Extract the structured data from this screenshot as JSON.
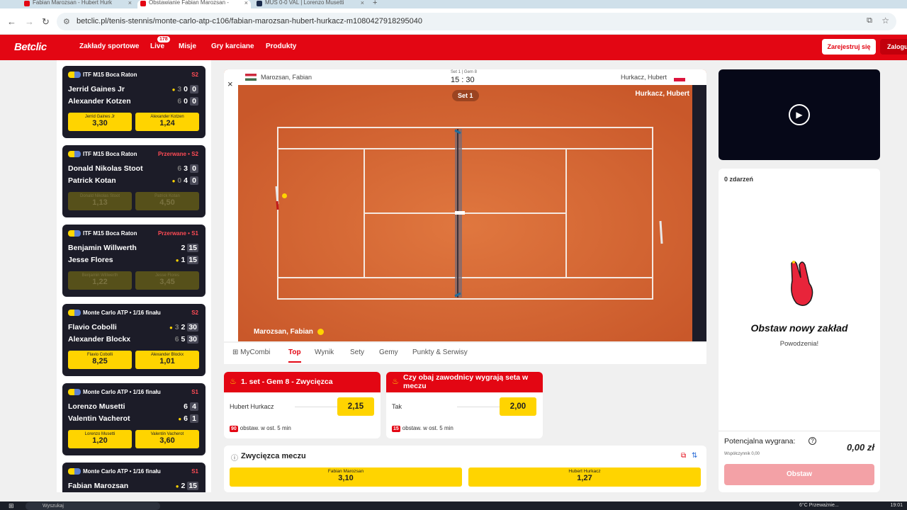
{
  "browser": {
    "tabs": [
      {
        "label": "Fabian Marozsan - Hubert Hurk",
        "active": false
      },
      {
        "label": "Obstawianie Fabian Marozsan -",
        "active": true
      },
      {
        "label": "MUS 0-0 VAL | Lorenzo Musetti",
        "active": false
      }
    ],
    "url": "betclic.pl/tenis-stennis/monte-carlo-atp-c106/fabian-marozsan-hubert-hurkacz-m1080427918295040"
  },
  "header": {
    "logo": "Betclic",
    "menu": [
      "Zakłady sportowe",
      "Live",
      "Misje",
      "Gry karciane",
      "Produkty"
    ],
    "live_count": "178",
    "register": "Zarejestruj się",
    "login": "Zaloguj"
  },
  "sidebar": {
    "matches": [
      {
        "league": "ITF M15 Boca Raton",
        "status": "S2",
        "p1": "Jerrid Gaines Jr",
        "p2": "Alexander Kotzen",
        "s1": "3",
        "g1": "0",
        "c1": "0",
        "s2": "6",
        "g2": "0",
        "c2": "0",
        "server": 1,
        "o1n": "Jerrid Gaines Jr",
        "o1": "3,30",
        "o2n": "Alexander Kotzen",
        "o2": "1,24",
        "suspended": false
      },
      {
        "league": "ITF M15 Boca Raton",
        "status": "Przerwane • S2",
        "p1": "Donald Nikolas Stoot",
        "p2": "Patrick Kotan",
        "s1": "6",
        "g1": "3",
        "c1": "0",
        "s2": "0",
        "g2": "4",
        "c2": "0",
        "server": 2,
        "o1n": "Donald Nikolas Stoot",
        "o1": "1,13",
        "o2n": "Patrick Kotan",
        "o2": "4,50",
        "suspended": true
      },
      {
        "league": "ITF M15 Boca Raton",
        "status": "Przerwane • S1",
        "p1": "Benjamin Willwerth",
        "p2": "Jesse Flores",
        "s1": "",
        "g1": "2",
        "c1": "15",
        "s2": "",
        "g2": "1",
        "c2": "15",
        "server": 2,
        "o1n": "Benjamin Willwerth",
        "o1": "1,22",
        "o2n": "Jesse Flores",
        "o2": "3,45",
        "suspended": true
      },
      {
        "league": "Monte Carlo ATP • 1/16 finału",
        "status": "S2",
        "p1": "Flavio Cobolli",
        "p2": "Alexander Blockx",
        "s1": "3",
        "g1": "2",
        "c1": "30",
        "s2": "6",
        "g2": "5",
        "c2": "30",
        "server": 1,
        "o1n": "Flavio Cobolli",
        "o1": "8,25",
        "o2n": "Alexander Blockx",
        "o2": "1,01",
        "suspended": false
      },
      {
        "league": "Monte Carlo ATP • 1/16 finału",
        "status": "S1",
        "p1": "Lorenzo Musetti",
        "p2": "Valentin Vacherot",
        "s1": "",
        "g1": "6",
        "c1": "4",
        "s2": "",
        "g2": "6",
        "c2": "1",
        "server": 2,
        "o1n": "Lorenzo Musetti",
        "o1": "1,20",
        "o2n": "Valentin Vacherot",
        "o2": "3,60",
        "suspended": false
      },
      {
        "league": "Monte Carlo ATP • 1/16 finału",
        "status": "S1",
        "p1": "Fabian Marozsan",
        "p2": "Hubert Hurkacz",
        "s1": "",
        "g1": "2",
        "c1": "15",
        "s2": "",
        "g2": "",
        "c2": "",
        "server": 1,
        "o1n": "",
        "o1": "",
        "o2n": "",
        "o2": "",
        "suspended": false
      }
    ]
  },
  "court": {
    "player1": "Marozsan, Fabian",
    "player2": "Hurkacz, Hubert",
    "set_info": "Set 1 | Gem 8",
    "score": "15 : 30",
    "set_pill": "Set 1",
    "server_top": "Hurkacz, Hubert",
    "server_bottom": "Marozsan, Fabian"
  },
  "tabs": [
    "MyCombi",
    "Top",
    "Wynik",
    "Sety",
    "Gemy",
    "Punkty & Serwisy"
  ],
  "active_tab": "Top",
  "bets": [
    {
      "title": "1. set - Gem 8 - Zwycięzca",
      "option": "Hubert Hurkacz",
      "odd": "2,15",
      "count": "90",
      "count_label": "obstaw. w ost. 5 min"
    },
    {
      "title": "Czy obaj zawodnicy wygrają seta w meczu",
      "option": "Tak",
      "odd": "2,00",
      "count": "15",
      "count_label": "obstaw. w ost. 5 min"
    }
  ],
  "winner": {
    "title": "Zwycięzca meczu",
    "p1": "Fabian Marozsan",
    "o1": "3,10",
    "p2": "Hubert Hurkacz",
    "o2": "1,27"
  },
  "slip": {
    "events": "0 zdarzeń",
    "title": "Obstaw nowy zakład",
    "subtitle": "Powodzenia!",
    "potential_label": "Potencjalna wygrana:",
    "potential_value": "0,00 zł",
    "coef_label": "Współczynnik 0,00",
    "place_button": "Obstaw"
  },
  "taskbar": {
    "search": "Wyszukaj",
    "tray": "6°C  Przeważnie...",
    "time": "19:01"
  },
  "colors": {
    "brand": "#e30613",
    "odds": "#ffd400",
    "court": "#d96a34"
  }
}
